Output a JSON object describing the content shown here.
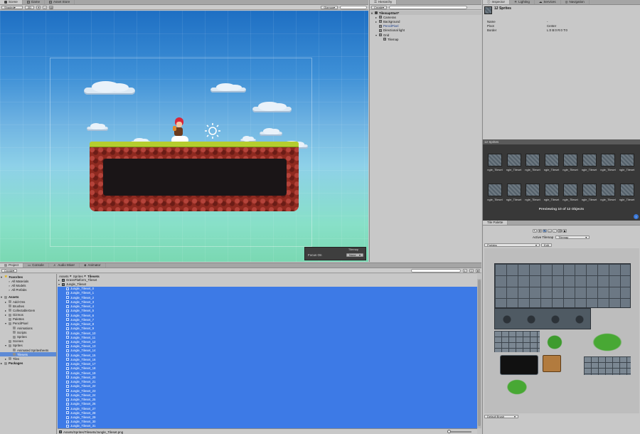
{
  "scene": {
    "tabs": [
      {
        "label": "Scene"
      },
      {
        "label": "Game"
      },
      {
        "label": "Asset Store"
      }
    ],
    "shading_mode": "Shaded",
    "mode_2d": "2D",
    "gizmos_label": "Gizmos",
    "search_placeholder": "All",
    "tilemap_overlay": {
      "title": "Tilemap",
      "focus_label": "Focus On",
      "focus_value": "None"
    }
  },
  "hierarchy": {
    "tab": "Hierarchy",
    "create_label": "Create",
    "root": "TilemapStart*",
    "items": [
      {
        "label": "Cameras",
        "indent": 1,
        "expander": "▸",
        "icon": "go",
        "color": "#111111"
      },
      {
        "label": "Background",
        "indent": 1,
        "expander": "▸",
        "icon": "go",
        "color": "#111111"
      },
      {
        "label": "PencilPixel",
        "indent": 1,
        "expander": "",
        "icon": "go",
        "color": "#1d3f8a"
      },
      {
        "label": "Directional light",
        "indent": 1,
        "expander": "",
        "icon": "go",
        "color": "#111111"
      },
      {
        "label": "Grid",
        "indent": 1,
        "expander": "▾",
        "icon": "go",
        "color": "#111111"
      },
      {
        "label": "Tilemap",
        "indent": 2,
        "expander": "",
        "icon": "go",
        "color": "#111111"
      }
    ]
  },
  "inspector": {
    "tabs": [
      {
        "label": "Inspector"
      },
      {
        "label": "Lighting"
      },
      {
        "label": "Services"
      },
      {
        "label": "Navigation"
      }
    ],
    "title": "12 Sprites",
    "fields": [
      {
        "label": "Name",
        "value": "-"
      },
      {
        "label": "Pivot",
        "value": "Center"
      },
      {
        "label": "Border",
        "value": "L:0 B:0 R:0 T:0"
      }
    ]
  },
  "preview": {
    "title": "12 Sprites",
    "thumb_label": "ngle_Tileset",
    "caption": "Previewing 10 of 12 Objects"
  },
  "tile_palette": {
    "tab": "Tile Palette",
    "active_tilemap_label": "Active Tilemap",
    "active_tilemap_value": "Tilemap",
    "palette_value": "Prefabs",
    "edit_label": "Edit",
    "brush_label": "Default Brush"
  },
  "project": {
    "tabs": [
      {
        "label": "Project"
      },
      {
        "label": "Console"
      },
      {
        "label": "Audio Mixer"
      },
      {
        "label": "Animator"
      }
    ],
    "create_label": "Create",
    "favorites": {
      "label": "Favorites",
      "items": [
        "All Materials",
        "All Models",
        "All Prefabs"
      ]
    },
    "assets_label": "Assets",
    "folders": [
      {
        "label": "Add-Ons",
        "indent": 1,
        "expander": "▸",
        "selected": false
      },
      {
        "label": "Brushes",
        "indent": 1,
        "expander": "",
        "selected": false
      },
      {
        "label": "CollectableGem",
        "indent": 1,
        "expander": "▸",
        "selected": false
      },
      {
        "label": "Gizmos",
        "indent": 1,
        "expander": "▸",
        "selected": false
      },
      {
        "label": "Palettes",
        "indent": 1,
        "expander": "",
        "selected": false
      },
      {
        "label": "PencilPixel",
        "indent": 1,
        "expander": "▾",
        "selected": false
      },
      {
        "label": "Animations",
        "indent": 2,
        "expander": "",
        "selected": false
      },
      {
        "label": "Scripts",
        "indent": 2,
        "expander": "",
        "selected": false
      },
      {
        "label": "Sprites",
        "indent": 2,
        "expander": "",
        "selected": false
      },
      {
        "label": "Scenes",
        "indent": 1,
        "expander": "",
        "selected": false
      },
      {
        "label": "Sprites",
        "indent": 1,
        "expander": "▾",
        "selected": false
      },
      {
        "label": "Animated Spritesheets",
        "indent": 2,
        "expander": "",
        "selected": false
      },
      {
        "label": "Tilesets",
        "indent": 2,
        "expander": "",
        "selected": true
      },
      {
        "label": "Tiles",
        "indent": 1,
        "expander": "▸",
        "selected": false
      }
    ],
    "packages_label": "Packages",
    "breadcrumb": [
      {
        "label": "Assets"
      },
      {
        "label": "Sprites"
      },
      {
        "label": "Tilesets"
      }
    ],
    "breadcrumb_sep": "▸",
    "asset_files": [
      {
        "label": "GrassPlatform_Tileset",
        "expander": "▸"
      },
      {
        "label": "Jungle_Tileset",
        "expander": "▾"
      }
    ],
    "sprites": [
      "Jungle_Tileset_0",
      "Jungle_Tileset_1",
      "Jungle_Tileset_2",
      "Jungle_Tileset_3",
      "Jungle_Tileset_4",
      "Jungle_Tileset_5",
      "Jungle_Tileset_6",
      "Jungle_Tileset_7",
      "Jungle_Tileset_8",
      "Jungle_Tileset_9",
      "Jungle_Tileset_10",
      "Jungle_Tileset_11",
      "Jungle_Tileset_12",
      "Jungle_Tileset_13",
      "Jungle_Tileset_14",
      "Jungle_Tileset_15",
      "Jungle_Tileset_16",
      "Jungle_Tileset_17",
      "Jungle_Tileset_18",
      "Jungle_Tileset_19",
      "Jungle_Tileset_20",
      "Jungle_Tileset_21",
      "Jungle_Tileset_22",
      "Jungle_Tileset_23",
      "Jungle_Tileset_24",
      "Jungle_Tileset_25",
      "Jungle_Tileset_26",
      "Jungle_Tileset_27",
      "Jungle_Tileset_28",
      "Jungle_Tileset_29",
      "Jungle_Tileset_30",
      "Jungle_Tileset_31"
    ],
    "status_path": "Assets/Sprites/Tilesets/Jungle_Tileset.png"
  }
}
